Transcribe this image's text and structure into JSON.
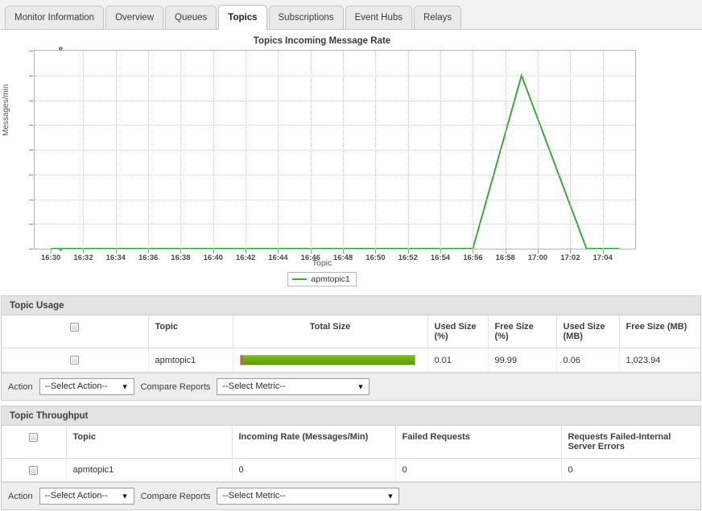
{
  "tabs": [
    {
      "label": "Monitor Information",
      "active": false
    },
    {
      "label": "Overview",
      "active": false
    },
    {
      "label": "Queues",
      "active": false
    },
    {
      "label": "Topics",
      "active": true
    },
    {
      "label": "Subscriptions",
      "active": false
    },
    {
      "label": "Event Hubs",
      "active": false
    },
    {
      "label": "Relays",
      "active": false
    }
  ],
  "chart_data": {
    "type": "line",
    "title": "Topics Incoming Message Rate",
    "xlabel": "Topic",
    "ylabel": "Messages/min",
    "ylim": [
      0,
      8
    ],
    "yticks": [
      0,
      1,
      2,
      3,
      4,
      5,
      6,
      7,
      8
    ],
    "xticks": [
      "16:30",
      "16:32",
      "16:34",
      "16:36",
      "16:38",
      "16:40",
      "16:42",
      "16:44",
      "16:46",
      "16:48",
      "16:50",
      "16:52",
      "16:54",
      "16:56",
      "16:58",
      "17:00",
      "17:02",
      "17:04"
    ],
    "grid": true,
    "legend_position": "bottom",
    "line_color": "#3aa93a",
    "series": [
      {
        "name": "apmtopic1",
        "x": [
          "16:30",
          "16:56",
          "16:59",
          "17:03",
          "17:05"
        ],
        "values": [
          0,
          0,
          7,
          0,
          0
        ]
      }
    ]
  },
  "topic_usage": {
    "title": "Topic Usage",
    "columns": [
      "",
      "Topic",
      "Total Size",
      "Used Size  (%)",
      "Free Size  (%)",
      "Used Size  (MB)",
      "Free Size  (MB)"
    ],
    "rows": [
      {
        "topic": "apmtopic1",
        "total_size_used_pct": 0.01,
        "used_size_pct": "0.01",
        "free_size_pct": "99.99",
        "used_size_mb": "0.06",
        "free_size_mb": "1,023.94"
      }
    ],
    "action_label": "Action",
    "action_value": "--Select Action--",
    "compare_label": "Compare Reports",
    "compare_value": "--Select Metric--"
  },
  "topic_throughput": {
    "title": "Topic Throughput",
    "columns": [
      "",
      "Topic",
      "Incoming Rate  (Messages/Min)",
      "Failed Requests",
      "Requests Failed-Internal Server Errors"
    ],
    "rows": [
      {
        "topic": "apmtopic1",
        "incoming_rate": "0",
        "failed_requests": "0",
        "requests_failed_internal": "0"
      }
    ],
    "action_label": "Action",
    "action_value": "--Select Action--",
    "compare_label": "Compare Reports",
    "compare_value": "--Select Metric--"
  },
  "icons": {
    "chevron_down": "▼"
  }
}
